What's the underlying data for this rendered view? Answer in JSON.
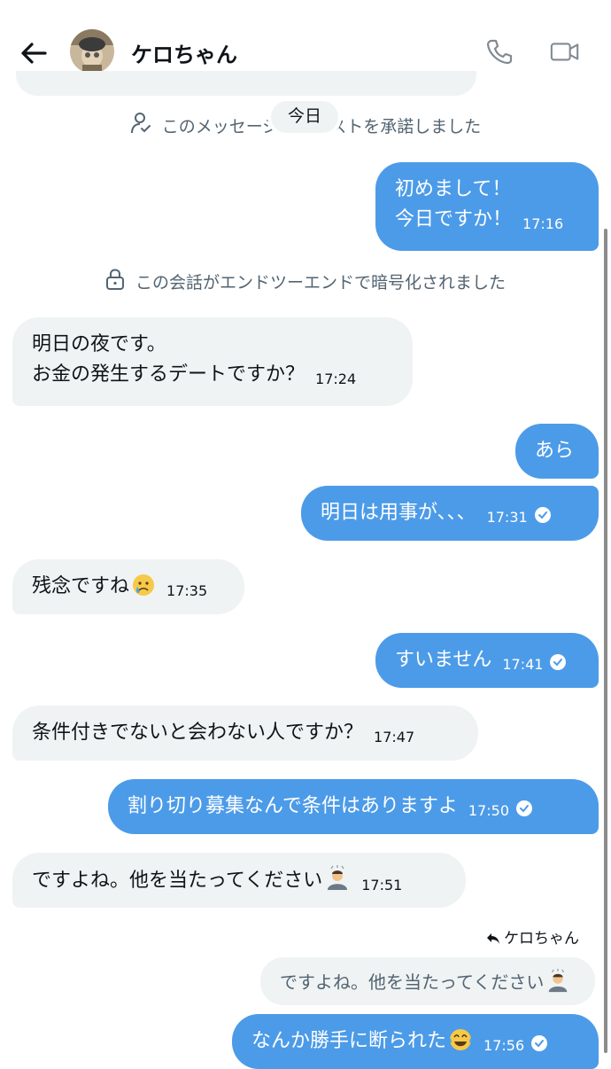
{
  "header": {
    "contact_name": "ケロちゃん"
  },
  "system": {
    "request_accepted": "このメッセージリクエストを承諾しました",
    "today_label": "今日",
    "encrypted": "この会話がエンドツーエンドで暗号化されました"
  },
  "messages": [
    {
      "dir": "out",
      "lines": [
        "初めまして！",
        "今日ですか！"
      ],
      "time": "17:16",
      "read": false
    },
    {
      "dir": "in",
      "lines": [
        "明日の夜です。",
        "お金の発生するデートですか？"
      ],
      "time": "17:24"
    },
    {
      "dir": "out",
      "lines": [
        "あら"
      ],
      "time": "",
      "read": false
    },
    {
      "dir": "out",
      "lines": [
        "明日は用事が、、、"
      ],
      "time": "17:31",
      "read": true
    },
    {
      "dir": "in",
      "lines": [
        "残念ですね"
      ],
      "emoji": "crying-face",
      "time": "17:35"
    },
    {
      "dir": "out",
      "lines": [
        "すいません"
      ],
      "time": "17:41",
      "read": true
    },
    {
      "dir": "in",
      "lines": [
        "条件付きでないと会わない人ですか？"
      ],
      "time": "17:47"
    },
    {
      "dir": "out",
      "lines": [
        "割り切り募集なんで条件はありますよ"
      ],
      "time": "17:50",
      "read": true
    },
    {
      "dir": "in",
      "lines": [
        "ですよね。他を当たってください"
      ],
      "emoji": "bowing-person",
      "time": "17:51"
    },
    {
      "dir": "out",
      "lines": [
        "なんか勝手に断られた"
      ],
      "emoji": "tears-of-joy",
      "time": "17:56",
      "read": true
    }
  ],
  "reply": {
    "to_label": "ケロちゃん",
    "quoted_text": "ですよね。他を当たってください"
  },
  "colors": {
    "outgoing": "#4c9be8",
    "incoming": "#eff3f4",
    "muted_text": "#536471"
  }
}
